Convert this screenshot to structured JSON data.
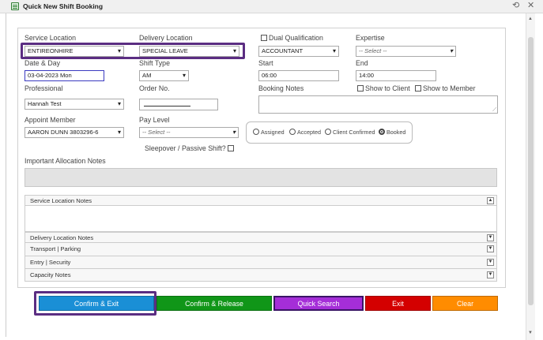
{
  "window": {
    "title": "Quick New Shift Booking"
  },
  "labels": {
    "service_location": "Service Location",
    "delivery_location": "Delivery Location",
    "dual_qualification": "Dual Qualification",
    "expertise": "Expertise",
    "date_day": "Date & Day",
    "shift_type": "Shift Type",
    "start": "Start",
    "end": "End",
    "professional": "Professional",
    "order_no": "Order No.",
    "booking_notes": "Booking Notes",
    "show_to_client": "Show to Client",
    "show_to_member": "Show to Member",
    "appoint_member": "Appoint Member",
    "pay_level": "Pay Level",
    "sleepover": "Sleepover / Passive Shift?",
    "important_notes": "Important Allocation Notes"
  },
  "fields": {
    "service_location": "ENTIREONHIRE",
    "delivery_location": "SPECIAL LEAVE",
    "qualification": "ACCOUNTANT",
    "expertise": "-- Select --",
    "date": "03-04-2023 Mon",
    "shift_type": "AM",
    "start": "06:00",
    "end": "14:00",
    "professional": "Hannah Test",
    "order_no": "",
    "appoint_member": "AARON DUNN 3803296-6",
    "pay_level": "-- Select --"
  },
  "status_options": [
    {
      "label": "Assigned",
      "selected": false
    },
    {
      "label": "Accepted",
      "selected": false
    },
    {
      "label": "Client Confirmed",
      "selected": false
    },
    {
      "label": "Booked",
      "selected": true
    }
  ],
  "note_sections": [
    {
      "label": "Service Location Notes",
      "expanded": true
    },
    {
      "label": "Delivery Location Notes",
      "expanded": false
    },
    {
      "label": "Transport | Parking",
      "expanded": false
    },
    {
      "label": "Entry | Security",
      "expanded": false
    },
    {
      "label": "Capacity Notes",
      "expanded": false
    }
  ],
  "buttons": {
    "confirm_exit": "Confirm & Exit",
    "confirm_release": "Confirm & Release",
    "quick_search": "Quick Search",
    "exit": "Exit",
    "clear": "Clear"
  },
  "colors": {
    "confirm_exit": "#1a8fd6",
    "confirm_release": "#109618",
    "quick_search": "#a52ed8",
    "exit": "#d40000",
    "clear": "#ff8c00",
    "highlight": "#5b2d82"
  },
  "icons": {
    "window": "calendar-icon",
    "pin": "pin-icon",
    "close": "close-icon",
    "collapse": "chevron-up-icon",
    "expand": "chevron-down-icon"
  }
}
